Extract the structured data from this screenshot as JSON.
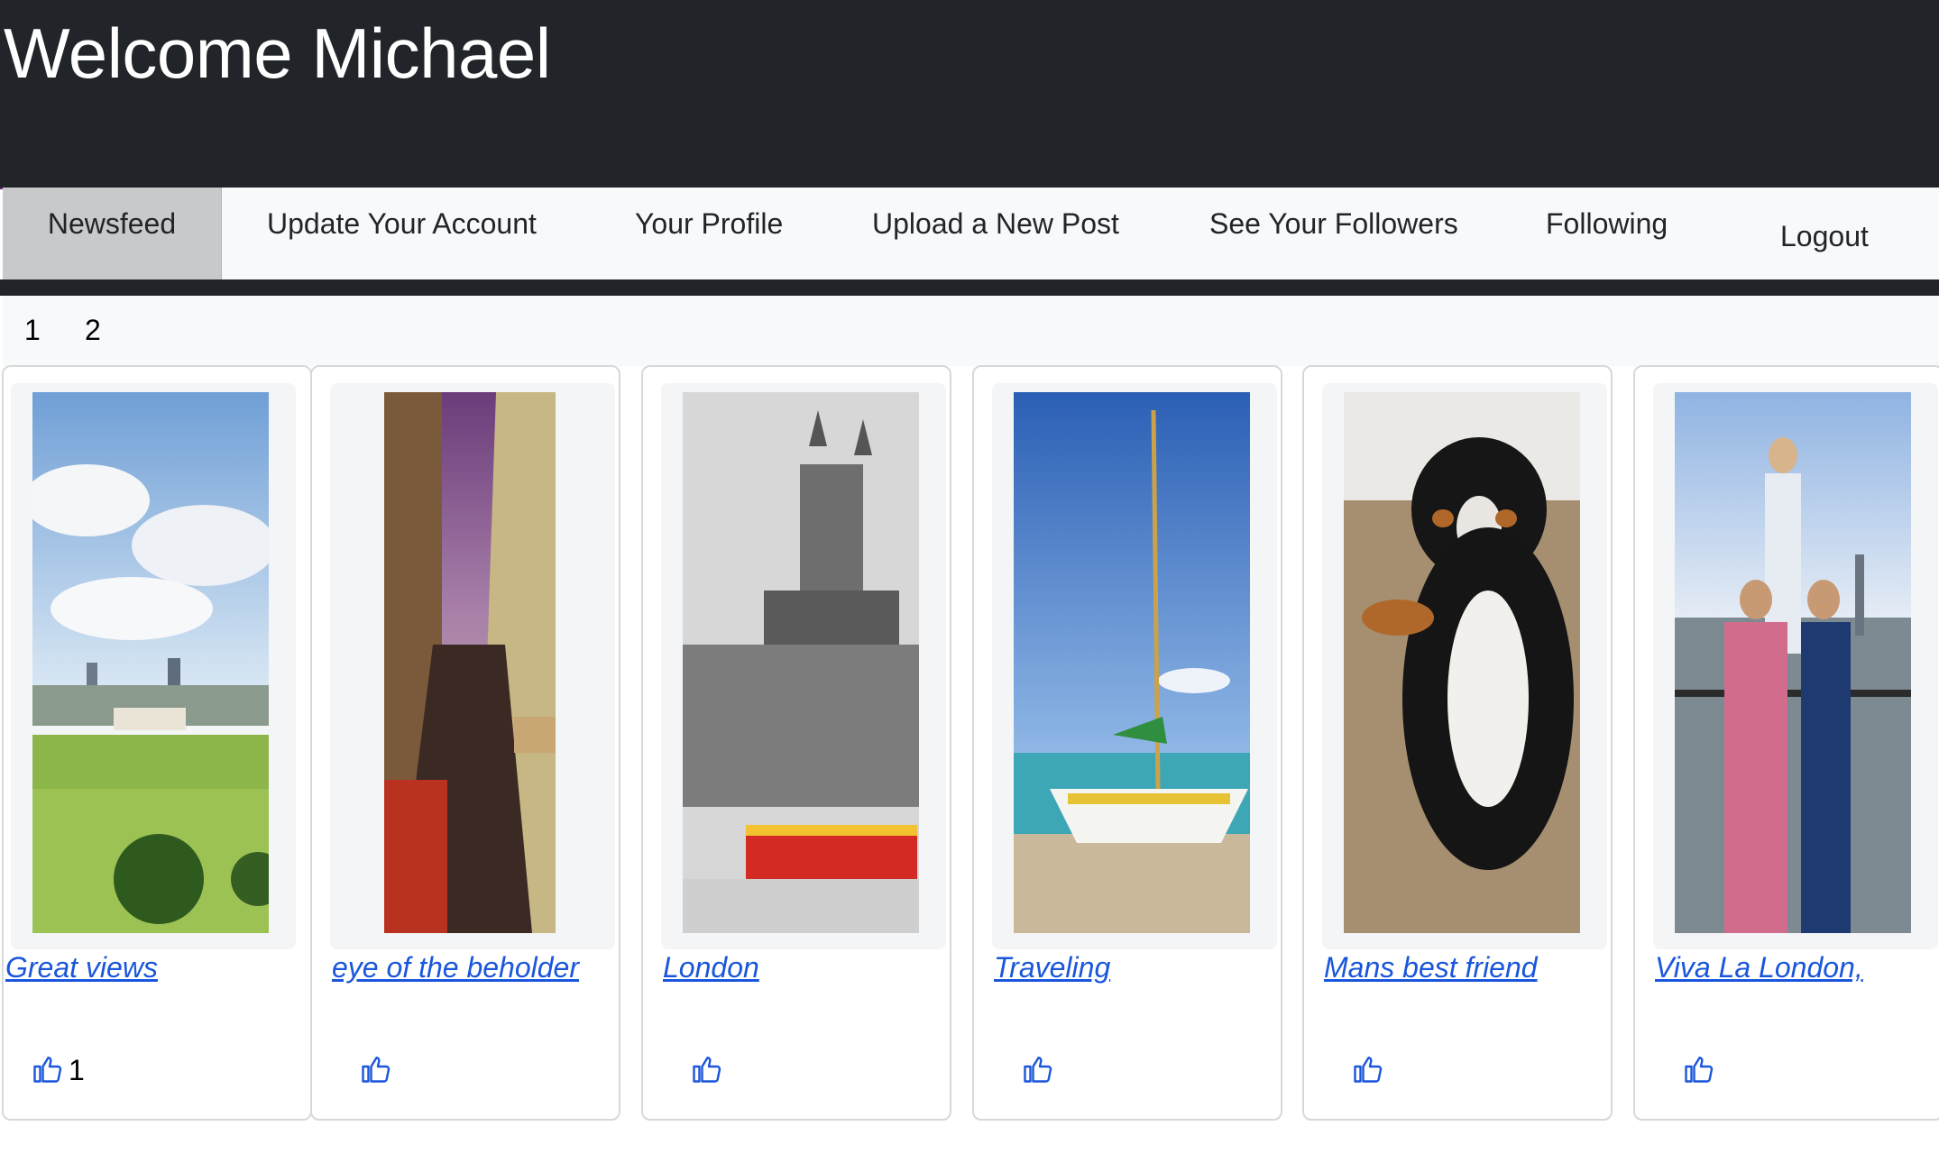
{
  "header": {
    "title": "Welcome Michael"
  },
  "nav": {
    "items": [
      {
        "label": "Newsfeed"
      },
      {
        "label": "Update Your Account"
      },
      {
        "label": "Your Profile"
      },
      {
        "label": "Upload a New Post"
      },
      {
        "label": "See Your Followers"
      },
      {
        "label": "Following"
      },
      {
        "label": "Logout"
      }
    ],
    "active": "Newsfeed"
  },
  "pagination": {
    "pages": [
      "1",
      "2"
    ]
  },
  "posts": [
    {
      "caption": "Great views",
      "likes": "1",
      "image": "greenwich-park-skyline"
    },
    {
      "caption": "eye of the beholder",
      "likes": "",
      "image": "street-with-bikes"
    },
    {
      "caption": "London",
      "likes": "",
      "image": "cathedral-with-red-bus"
    },
    {
      "caption": "Traveling",
      "likes": "",
      "image": "sailboat-on-beach"
    },
    {
      "caption": "Mans best friend",
      "likes": "",
      "image": "tricolor-dog"
    },
    {
      "caption": "Viva La London,",
      "likes": "",
      "image": "people-by-river"
    }
  ],
  "colors": {
    "header_bg": "#212529",
    "nav_bg": "#f8f9fa",
    "active_tab": "#c8c9ca",
    "link": "#1a56db"
  }
}
